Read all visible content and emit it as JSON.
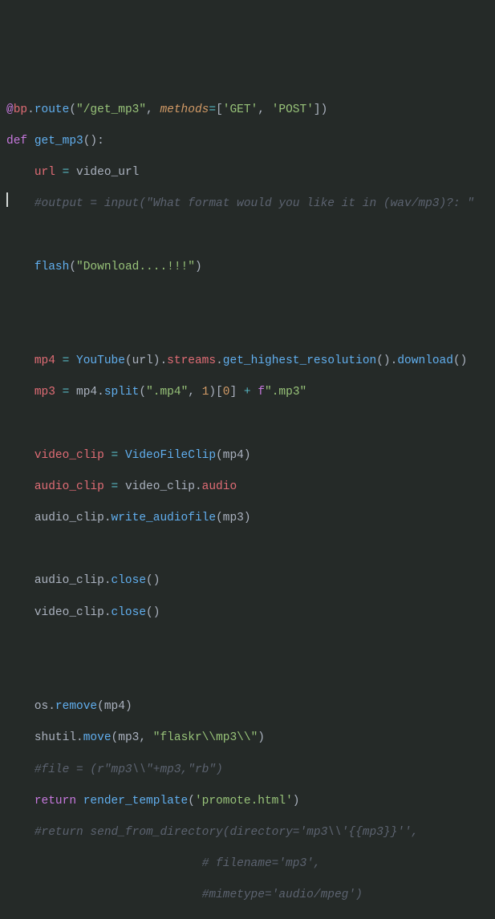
{
  "code": {
    "l1": {
      "at": "@",
      "bp": "bp",
      "dot1": ".",
      "route": "route",
      "open": "(",
      "path": "\"/get_mp3\"",
      "comma1": ", ",
      "methods_kw": "methods",
      "eq": "=",
      "lbrack": "[",
      "get": "'GET'",
      "comma2": ", ",
      "post": "'POST'",
      "rbrack": "]",
      "close": ")"
    },
    "l2": {
      "def": "def",
      "sp": " ",
      "name": "get_mp3",
      "paren": "():"
    },
    "l3": {
      "indent": "    ",
      "url": "url",
      "sp1": " ",
      "eq": "=",
      "sp2": " ",
      "video_url": "video_url"
    },
    "l4": {
      "indent": "    ",
      "txt": "#output = input(\"What format would you like it in (wav/mp3)?: \""
    },
    "l6": {
      "indent": "    ",
      "flash": "flash",
      "open": "(",
      "msg": "\"Download....!!!\"",
      "close": ")"
    },
    "l8": {
      "indent": "    ",
      "mp4": "mp4",
      "sp1": " ",
      "eq": "=",
      "sp2": " ",
      "YouTube": "YouTube",
      "open1": "(",
      "url": "url",
      "close1": ")",
      "dot1": ".",
      "streams": "streams",
      "dot2": ".",
      "ghr": "get_highest_resolution",
      "paren2": "()",
      "dot3": ".",
      "download": "download",
      "paren3": "()"
    },
    "l9": {
      "indent": "    ",
      "mp3": "mp3",
      "sp1": " ",
      "eq": "=",
      "sp2": " ",
      "mp4": "mp4",
      "dot": ".",
      "split": "split",
      "open": "(",
      "ext": "\".mp4\"",
      "comma": ", ",
      "one": "1",
      "close": ")",
      "lbrack": "[",
      "zero": "0",
      "rbrack": "]",
      "sp3": " ",
      "plus": "+",
      "sp4": " ",
      "f": "f",
      "ext2": "\".mp3\""
    },
    "l11": {
      "indent": "    ",
      "vc": "video_clip",
      "sp1": " ",
      "eq": "=",
      "sp2": " ",
      "VFC": "VideoFileClip",
      "open": "(",
      "mp4": "mp4",
      "close": ")"
    },
    "l12": {
      "indent": "    ",
      "ac": "audio_clip",
      "sp1": " ",
      "eq": "=",
      "sp2": " ",
      "vc": "video_clip",
      "dot": ".",
      "audio": "audio"
    },
    "l13": {
      "indent": "    ",
      "ac": "audio_clip",
      "dot": ".",
      "wa": "write_audiofile",
      "open": "(",
      "mp3": "mp3",
      "close": ")"
    },
    "l15": {
      "indent": "    ",
      "ac": "audio_clip",
      "dot": ".",
      "close": "close",
      "paren": "()"
    },
    "l16": {
      "indent": "    ",
      "vc": "video_clip",
      "dot": ".",
      "close": "close",
      "paren": "()"
    },
    "l19": {
      "indent": "    ",
      "os": "os",
      "dot": ".",
      "remove": "remove",
      "open": "(",
      "mp4": "mp4",
      "close": ")"
    },
    "l20": {
      "indent": "    ",
      "shutil": "shutil",
      "dot": ".",
      "move": "move",
      "open": "(",
      "mp3": "mp3",
      "comma": ", ",
      "path": "\"flaskr\\\\mp3\\\\\"",
      "close": ")"
    },
    "l21": {
      "indent": "    ",
      "txt": "#file = (r\"mp3\\\\\"+mp3,\"rb\")"
    },
    "l22": {
      "indent": "    ",
      "ret": "return",
      "sp": " ",
      "rt": "render_template",
      "open": "(",
      "tmpl": "'promote.html'",
      "close": ")"
    },
    "l23": {
      "indent": "    ",
      "txt": "#return send_from_directory(directory='mp3\\\\'{{mp3}}'',"
    },
    "l24": {
      "indent": "                            ",
      "txt": "# filename='mp3',"
    },
    "l25": {
      "indent": "                            ",
      "txt": "#mimetype='audio/mpeg')"
    }
  }
}
